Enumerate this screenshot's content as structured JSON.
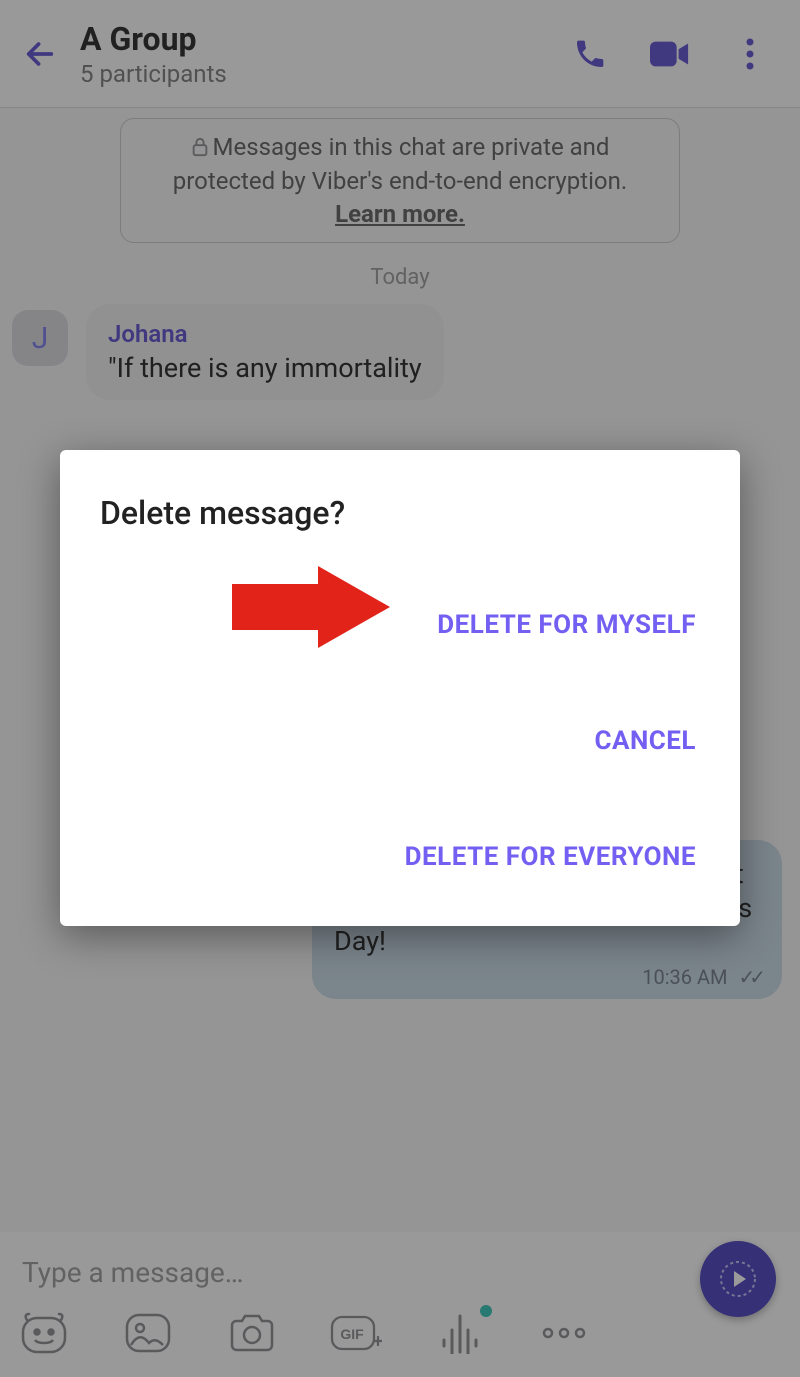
{
  "header": {
    "title": "A Group",
    "subtitle": "5 participants"
  },
  "encryption": {
    "text_prefix": "Messages in this chat are private and protected by Viber's end-to-end encryption. ",
    "learn_more": "Learn more."
  },
  "date_separator": "Today",
  "incoming_message": {
    "avatar_initial": "J",
    "sender": "Johana",
    "text": "\"If there is any immortality"
  },
  "outgoing_message": {
    "text": "be able to pay you back for all that you've done for me. Happy Father's Day!",
    "time": "10:36 AM"
  },
  "composer": {
    "placeholder": "Type a message…"
  },
  "dialog": {
    "title": "Delete message?",
    "option_for_myself": "DELETE FOR MYSELF",
    "option_cancel": "CANCEL",
    "option_for_everyone": "DELETE FOR EVERYONE"
  },
  "colors": {
    "accent": "#7360f2",
    "header_icon": "#5b4fcf",
    "arrow": "#e2231a"
  }
}
